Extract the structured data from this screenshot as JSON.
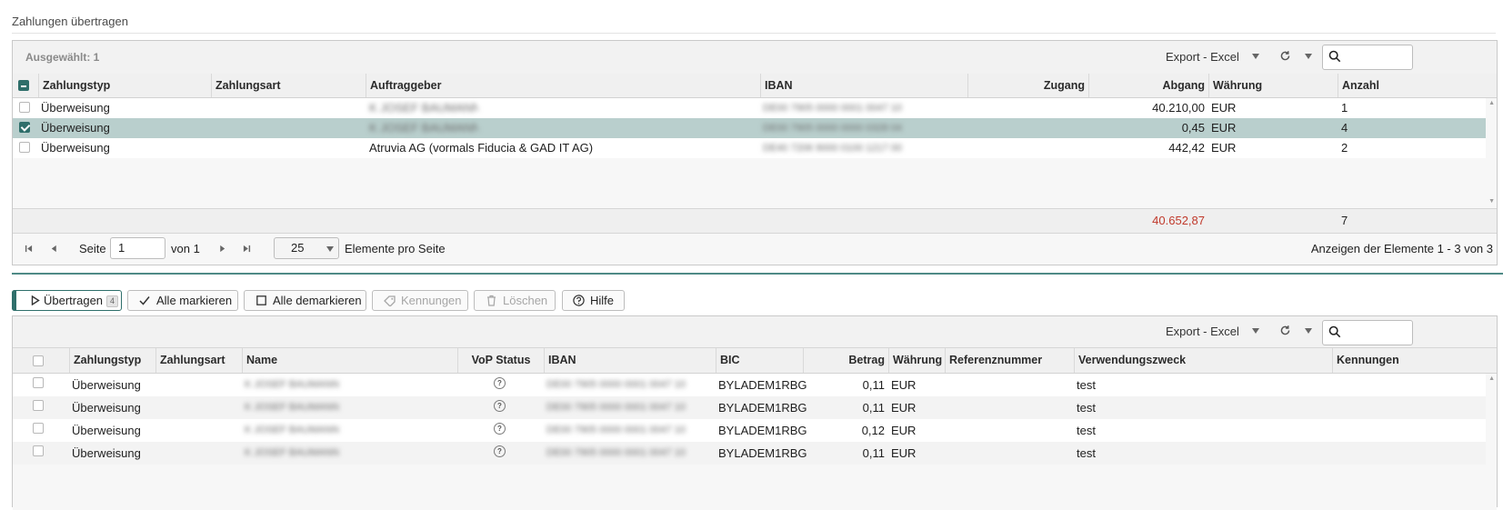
{
  "section_title": "Zahlungen übertragen",
  "top_grid": {
    "selected_label": "Ausgewählt: 1",
    "export_label": "Export - Excel",
    "columns": [
      "Zahlungstyp",
      "Zahlungsart",
      "Auftraggeber",
      "IBAN",
      "Zugang",
      "Abgang",
      "Währung",
      "Anzahl"
    ],
    "rows": [
      {
        "typ": "Überweisung",
        "art": "",
        "auftraggeber": "K JOSEF BAUMANN 1",
        "iban": "DE00 7905 0000 0001 0047 10",
        "zugang": "",
        "abgang": "40.210,00",
        "waehrung": "EUR",
        "anzahl": "1",
        "selected": false
      },
      {
        "typ": "Überweisung",
        "art": "",
        "auftraggeber": "K JOSEF BAUMANN 2",
        "iban": "DE00 7905 0000 0000 0328 04",
        "zugang": "",
        "abgang": "0,45",
        "waehrung": "EUR",
        "anzahl": "4",
        "selected": true
      },
      {
        "typ": "Überweisung",
        "art": "",
        "auftraggeber": "Atruvia AG (vormals Fiducia & GAD IT AG)",
        "iban": "DE40 7206 9000 0100 1217 00",
        "zugang": "",
        "abgang": "442,42",
        "waehrung": "EUR",
        "anzahl": "2",
        "selected": false
      }
    ],
    "total_abgang": "40.652,87",
    "total_anzahl": "7",
    "pager": {
      "page_label": "Seite",
      "page_value": "1",
      "of_label": "von 1",
      "page_size": "25",
      "per_page_label": "Elemente pro Seite",
      "range_label": "Anzeigen der Elemente 1 - 3 von 3"
    },
    "colors": {
      "total_red": "#c0392b",
      "selected_row": "#b9cfcd",
      "accent": "#2e6e6a"
    }
  },
  "actions": {
    "transfer_label": "Übertragen",
    "transfer_count": "4",
    "mark_all_label": "Alle markieren",
    "unmark_all_label": "Alle demarkieren",
    "tags_label": "Kennungen",
    "delete_label": "Löschen",
    "help_label": "Hilfe"
  },
  "bottom_grid": {
    "export_label": "Export - Excel",
    "columns": [
      "Zahlungstyp",
      "Zahlungsart",
      "Name",
      "VoP Status",
      "IBAN",
      "BIC",
      "Betrag",
      "Währung",
      "Referenznummer",
      "Verwendungszweck",
      "Kennungen"
    ],
    "rows": [
      {
        "typ": "Überweisung",
        "art": "",
        "name": "K JOSEF BAUMANN",
        "vop": "?",
        "iban": "DE00 7905 0000 0001 0047 10",
        "bic": "BYLADEM1RBG",
        "betrag": "0,11",
        "waehrung": "EUR",
        "referenz": "",
        "zweck": "test",
        "kennungen": ""
      },
      {
        "typ": "Überweisung",
        "art": "",
        "name": "K JOSEF BAUMANN",
        "vop": "?",
        "iban": "DE00 7905 0000 0001 0047 10",
        "bic": "BYLADEM1RBG",
        "betrag": "0,11",
        "waehrung": "EUR",
        "referenz": "",
        "zweck": "test",
        "kennungen": ""
      },
      {
        "typ": "Überweisung",
        "art": "",
        "name": "K JOSEF BAUMANN",
        "vop": "?",
        "iban": "DE00 7905 0000 0001 0047 10",
        "bic": "BYLADEM1RBG",
        "betrag": "0,12",
        "waehrung": "EUR",
        "referenz": "",
        "zweck": "test",
        "kennungen": ""
      },
      {
        "typ": "Überweisung",
        "art": "",
        "name": "K JOSEF BAUMANN",
        "vop": "?",
        "iban": "DE00 7905 0000 0001 0047 10",
        "bic": "BYLADEM1RBG",
        "betrag": "0,11",
        "waehrung": "EUR",
        "referenz": "",
        "zweck": "test",
        "kennungen": ""
      }
    ]
  }
}
